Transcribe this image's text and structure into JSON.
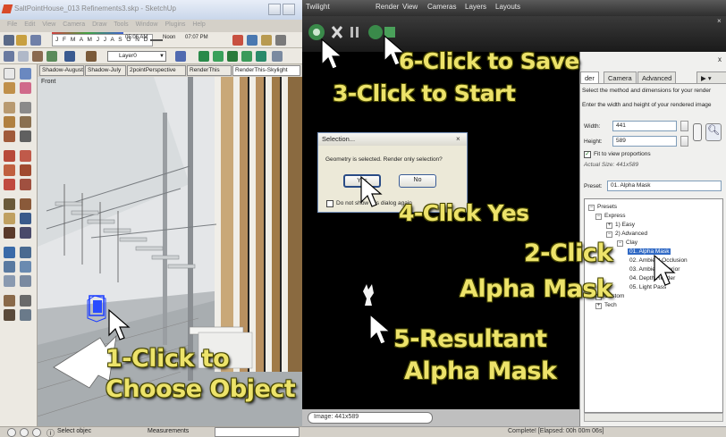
{
  "sketchup": {
    "title": "SaltPointHouse_013 Refinements3.skp - SketchUp",
    "menu": [
      "File",
      "Edit",
      "View",
      "Camera",
      "Draw",
      "Tools",
      "Window",
      "Plugins",
      "Help"
    ],
    "shadow_months": "J F M A M J J A S O N D",
    "time_start": "05:06 AM",
    "noon": "Noon",
    "time_end": "07:07 PM",
    "layer": "Layer0",
    "scene_tabs": [
      "Shadow-August",
      "Shadow-July",
      "2pointPerspective",
      "RenderThis",
      "RenderThis-Skylight"
    ],
    "view_label": "Front",
    "status_text": "Select objec",
    "measurements_label": "Measurements"
  },
  "twilight": {
    "menu": [
      "Twilight",
      "Render",
      "View",
      "Cameras",
      "Layers",
      "Layouts"
    ],
    "image_info": "Image: 441x589",
    "status": "Complete!  [Elapsed: 00h 00m 06s]"
  },
  "panel": {
    "close": "x",
    "tabs": [
      "der",
      "Camera",
      "Advanced"
    ],
    "tab_arrows": "▶ ▾",
    "desc1": "Select the method and dimensions for your render",
    "desc2": "Enter the width and height of your rendered image",
    "width_label": "Width:",
    "width_value": "441",
    "height_label": "Height:",
    "height_value": "589",
    "fit_label": "Fit to view proportions",
    "actual_size": "Actual Size: 441x589",
    "preset_label": "Preset:",
    "preset_value": "01. Alpha Mask",
    "tree": [
      {
        "label": "Presets",
        "toggle": "−"
      },
      {
        "label": "Express",
        "toggle": "−"
      },
      {
        "label": "1) Easy",
        "toggle": "+"
      },
      {
        "label": "2) Advanced",
        "toggle": "−"
      },
      {
        "label": "Clay",
        "toggle": "−"
      },
      {
        "label": "01. Alpha Mask",
        "toggle": ""
      },
      {
        "label": "02. Ambient Occlusion",
        "toggle": ""
      },
      {
        "label": "03. Ambient Interior",
        "toggle": ""
      },
      {
        "label": "04. Depth Render",
        "toggle": ""
      },
      {
        "label": "05. Light Pass",
        "toggle": ""
      },
      {
        "label": "Custom",
        "toggle": "+"
      },
      {
        "label": "Tech",
        "toggle": "+"
      }
    ]
  },
  "dialog": {
    "title": "Selection...",
    "message": "Geometry is selected.  Render only selection?",
    "yes": "Yes",
    "no": "No",
    "checkbox_label": "Do not show this dialog again"
  },
  "callouts": {
    "c1a": "1-Click to",
    "c1b": "Choose Object",
    "c2a": "2-Click",
    "c2b": "Alpha Mask",
    "c3": "3-Click to Start",
    "c4": "4-Click Yes",
    "c5a": "5-Resultant",
    "c5b": "Alpha Mask",
    "c6": "6-Click to Save"
  },
  "colors": {
    "callout": "#ede36a",
    "highlight": "#316ac5",
    "selection_box": "#1a3cff"
  }
}
